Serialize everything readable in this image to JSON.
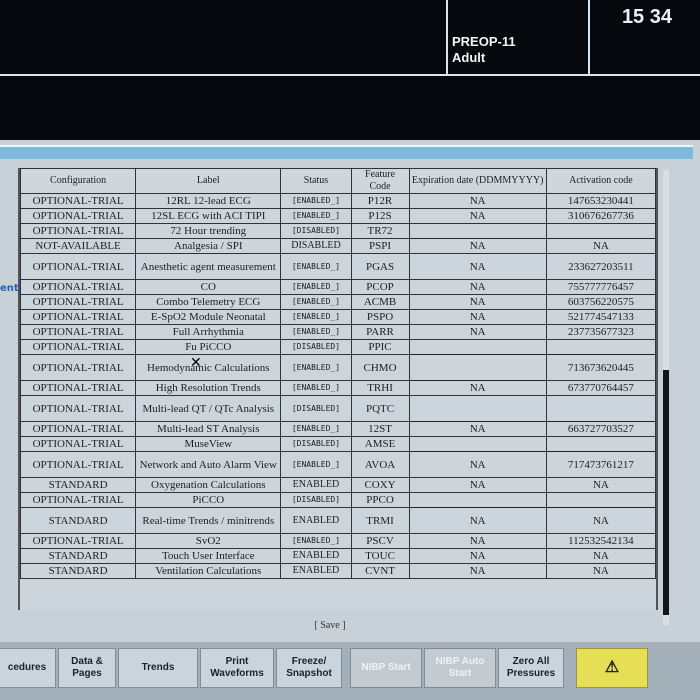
{
  "header": {
    "time": "15 34",
    "patient_id": "PREOP-11",
    "patient_type": "Adult"
  },
  "side_label": "ent",
  "table": {
    "columns": [
      "Configuration",
      "Label",
      "Status",
      "Feature Code",
      "Expiration date (DDMMYYYY)",
      "Activation code"
    ],
    "rows": [
      {
        "config": "OPTIONAL-TRIAL",
        "label": "12RL 12-lead ECG",
        "status": "[ENABLED_]",
        "code": "P12R",
        "expiry": "NA",
        "activation": "147653230441"
      },
      {
        "config": "OPTIONAL-TRIAL",
        "label": "12SL ECG with ACI TIPI",
        "status": "[ENABLED_]",
        "code": "P12S",
        "expiry": "NA",
        "activation": "310676267736"
      },
      {
        "config": "OPTIONAL-TRIAL",
        "label": "72 Hour trending",
        "status": "[DISABLED]",
        "code": "TR72",
        "expiry": "",
        "activation": ""
      },
      {
        "config": "NOT-AVAILABLE",
        "label": "Analgesia / SPI",
        "status": "DISABLED",
        "code": "PSPI",
        "expiry": "NA",
        "activation": "NA"
      },
      {
        "config": "OPTIONAL-TRIAL",
        "label": "Anesthetic agent measurement",
        "status": "[ENABLED_]",
        "code": "PGAS",
        "expiry": "NA",
        "activation": "233627203511"
      },
      {
        "config": "OPTIONAL-TRIAL",
        "label": "CO",
        "status": "[ENABLED_]",
        "code": "PCOP",
        "expiry": "NA",
        "activation": "755777776457"
      },
      {
        "config": "OPTIONAL-TRIAL",
        "label": "Combo Telemetry ECG",
        "status": "[ENABLED_]",
        "code": "ACMB",
        "expiry": "NA",
        "activation": "603756220575"
      },
      {
        "config": "OPTIONAL-TRIAL",
        "label": "E-SpO2 Module Neonatal",
        "status": "[ENABLED_]",
        "code": "PSPO",
        "expiry": "NA",
        "activation": "521774547133"
      },
      {
        "config": "OPTIONAL-TRIAL",
        "label": "Full Arrhythmia",
        "status": "[ENABLED_]",
        "code": "PARR",
        "expiry": "NA",
        "activation": "237735677323"
      },
      {
        "config": "OPTIONAL-TRIAL",
        "label": "Fu PiCCO",
        "status": "[DISABLED]",
        "code": "PPIC",
        "expiry": "",
        "activation": ""
      },
      {
        "config": "OPTIONAL-TRIAL",
        "label": "Hemodynamic Calculations",
        "status": "[ENABLED_]",
        "code": "CHMO",
        "expiry": "",
        "activation": "713673620445"
      },
      {
        "config": "OPTIONAL-TRIAL",
        "label": "High Resolution Trends",
        "status": "[ENABLED_]",
        "code": "TRHI",
        "expiry": "NA",
        "activation": "673770764457"
      },
      {
        "config": "OPTIONAL-TRIAL",
        "label": "Multi-lead QT / QTc Analysis",
        "status": "[DISABLED]",
        "code": "PQTC",
        "expiry": "",
        "activation": ""
      },
      {
        "config": "OPTIONAL-TRIAL",
        "label": "Multi-lead ST Analysis",
        "status": "[ENABLED_]",
        "code": "12ST",
        "expiry": "NA",
        "activation": "663727703527"
      },
      {
        "config": "OPTIONAL-TRIAL",
        "label": "MuseView",
        "status": "[DISABLED]",
        "code": "AMSE",
        "expiry": "",
        "activation": ""
      },
      {
        "config": "OPTIONAL-TRIAL",
        "label": "Network and Auto Alarm View",
        "status": "[ENABLED_]",
        "code": "AVOA",
        "expiry": "NA",
        "activation": "717473761217"
      },
      {
        "config": "STANDARD",
        "label": "Oxygenation Calculations",
        "status": "ENABLED",
        "code": "COXY",
        "expiry": "NA",
        "activation": "NA"
      },
      {
        "config": "OPTIONAL-TRIAL",
        "label": "PiCCO",
        "status": "[DISABLED]",
        "code": "PPCO",
        "expiry": "",
        "activation": ""
      },
      {
        "config": "STANDARD",
        "label": "Real-time Trends / minitrends",
        "status": "ENABLED",
        "code": "TRMI",
        "expiry": "NA",
        "activation": "NA"
      },
      {
        "config": "OPTIONAL-TRIAL",
        "label": "SvO2",
        "status": "[ENABLED_]",
        "code": "PSCV",
        "expiry": "NA",
        "activation": "112532542134"
      },
      {
        "config": "STANDARD",
        "label": "Touch User Interface",
        "status": "ENABLED",
        "code": "TOUC",
        "expiry": "NA",
        "activation": "NA"
      },
      {
        "config": "STANDARD",
        "label": "Ventilation Calculations",
        "status": "ENABLED",
        "code": "CVNT",
        "expiry": "NA",
        "activation": "NA"
      }
    ]
  },
  "save_label": "[ Save ]",
  "bottom_buttons": [
    {
      "label": "cedures"
    },
    {
      "label": "Data & Pages"
    },
    {
      "label": "Trends"
    },
    {
      "label": "Print Waveforms"
    },
    {
      "label": "Freeze/ Snapshot"
    },
    {
      "label": "NIBP Start"
    },
    {
      "label": "NIBP Auto Start"
    },
    {
      "label": "Zero All Pressures"
    }
  ]
}
